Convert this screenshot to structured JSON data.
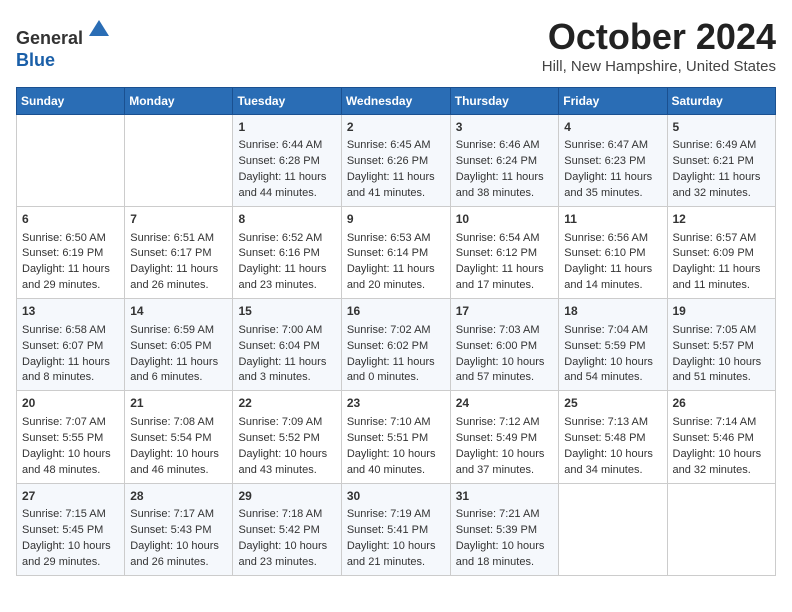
{
  "header": {
    "logo_line1": "General",
    "logo_line2": "Blue",
    "month": "October 2024",
    "location": "Hill, New Hampshire, United States"
  },
  "days_of_week": [
    "Sunday",
    "Monday",
    "Tuesday",
    "Wednesday",
    "Thursday",
    "Friday",
    "Saturday"
  ],
  "weeks": [
    [
      {
        "day": "",
        "content": ""
      },
      {
        "day": "",
        "content": ""
      },
      {
        "day": "1",
        "content": "Sunrise: 6:44 AM\nSunset: 6:28 PM\nDaylight: 11 hours and 44 minutes."
      },
      {
        "day": "2",
        "content": "Sunrise: 6:45 AM\nSunset: 6:26 PM\nDaylight: 11 hours and 41 minutes."
      },
      {
        "day": "3",
        "content": "Sunrise: 6:46 AM\nSunset: 6:24 PM\nDaylight: 11 hours and 38 minutes."
      },
      {
        "day": "4",
        "content": "Sunrise: 6:47 AM\nSunset: 6:23 PM\nDaylight: 11 hours and 35 minutes."
      },
      {
        "day": "5",
        "content": "Sunrise: 6:49 AM\nSunset: 6:21 PM\nDaylight: 11 hours and 32 minutes."
      }
    ],
    [
      {
        "day": "6",
        "content": "Sunrise: 6:50 AM\nSunset: 6:19 PM\nDaylight: 11 hours and 29 minutes."
      },
      {
        "day": "7",
        "content": "Sunrise: 6:51 AM\nSunset: 6:17 PM\nDaylight: 11 hours and 26 minutes."
      },
      {
        "day": "8",
        "content": "Sunrise: 6:52 AM\nSunset: 6:16 PM\nDaylight: 11 hours and 23 minutes."
      },
      {
        "day": "9",
        "content": "Sunrise: 6:53 AM\nSunset: 6:14 PM\nDaylight: 11 hours and 20 minutes."
      },
      {
        "day": "10",
        "content": "Sunrise: 6:54 AM\nSunset: 6:12 PM\nDaylight: 11 hours and 17 minutes."
      },
      {
        "day": "11",
        "content": "Sunrise: 6:56 AM\nSunset: 6:10 PM\nDaylight: 11 hours and 14 minutes."
      },
      {
        "day": "12",
        "content": "Sunrise: 6:57 AM\nSunset: 6:09 PM\nDaylight: 11 hours and 11 minutes."
      }
    ],
    [
      {
        "day": "13",
        "content": "Sunrise: 6:58 AM\nSunset: 6:07 PM\nDaylight: 11 hours and 8 minutes."
      },
      {
        "day": "14",
        "content": "Sunrise: 6:59 AM\nSunset: 6:05 PM\nDaylight: 11 hours and 6 minutes."
      },
      {
        "day": "15",
        "content": "Sunrise: 7:00 AM\nSunset: 6:04 PM\nDaylight: 11 hours and 3 minutes."
      },
      {
        "day": "16",
        "content": "Sunrise: 7:02 AM\nSunset: 6:02 PM\nDaylight: 11 hours and 0 minutes."
      },
      {
        "day": "17",
        "content": "Sunrise: 7:03 AM\nSunset: 6:00 PM\nDaylight: 10 hours and 57 minutes."
      },
      {
        "day": "18",
        "content": "Sunrise: 7:04 AM\nSunset: 5:59 PM\nDaylight: 10 hours and 54 minutes."
      },
      {
        "day": "19",
        "content": "Sunrise: 7:05 AM\nSunset: 5:57 PM\nDaylight: 10 hours and 51 minutes."
      }
    ],
    [
      {
        "day": "20",
        "content": "Sunrise: 7:07 AM\nSunset: 5:55 PM\nDaylight: 10 hours and 48 minutes."
      },
      {
        "day": "21",
        "content": "Sunrise: 7:08 AM\nSunset: 5:54 PM\nDaylight: 10 hours and 46 minutes."
      },
      {
        "day": "22",
        "content": "Sunrise: 7:09 AM\nSunset: 5:52 PM\nDaylight: 10 hours and 43 minutes."
      },
      {
        "day": "23",
        "content": "Sunrise: 7:10 AM\nSunset: 5:51 PM\nDaylight: 10 hours and 40 minutes."
      },
      {
        "day": "24",
        "content": "Sunrise: 7:12 AM\nSunset: 5:49 PM\nDaylight: 10 hours and 37 minutes."
      },
      {
        "day": "25",
        "content": "Sunrise: 7:13 AM\nSunset: 5:48 PM\nDaylight: 10 hours and 34 minutes."
      },
      {
        "day": "26",
        "content": "Sunrise: 7:14 AM\nSunset: 5:46 PM\nDaylight: 10 hours and 32 minutes."
      }
    ],
    [
      {
        "day": "27",
        "content": "Sunrise: 7:15 AM\nSunset: 5:45 PM\nDaylight: 10 hours and 29 minutes."
      },
      {
        "day": "28",
        "content": "Sunrise: 7:17 AM\nSunset: 5:43 PM\nDaylight: 10 hours and 26 minutes."
      },
      {
        "day": "29",
        "content": "Sunrise: 7:18 AM\nSunset: 5:42 PM\nDaylight: 10 hours and 23 minutes."
      },
      {
        "day": "30",
        "content": "Sunrise: 7:19 AM\nSunset: 5:41 PM\nDaylight: 10 hours and 21 minutes."
      },
      {
        "day": "31",
        "content": "Sunrise: 7:21 AM\nSunset: 5:39 PM\nDaylight: 10 hours and 18 minutes."
      },
      {
        "day": "",
        "content": ""
      },
      {
        "day": "",
        "content": ""
      }
    ]
  ]
}
